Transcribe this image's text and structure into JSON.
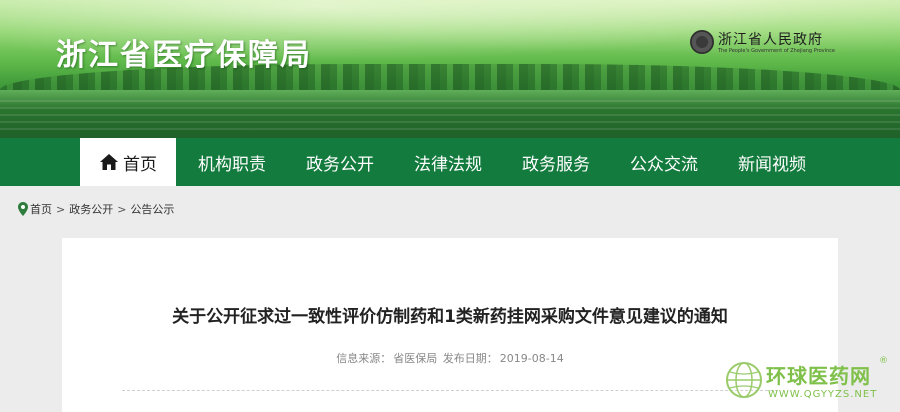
{
  "header": {
    "site_title": "浙江省医疗保障局",
    "gov_name": "浙江省人民政府",
    "gov_subtitle": "The People's Government of Zhejiang Province"
  },
  "nav": {
    "items": [
      {
        "label": "首页",
        "icon": "home-icon",
        "active": true
      },
      {
        "label": "机构职责"
      },
      {
        "label": "政务公开"
      },
      {
        "label": "法律法规"
      },
      {
        "label": "政务服务"
      },
      {
        "label": "公众交流"
      },
      {
        "label": "新闻视频"
      }
    ]
  },
  "breadcrumb": {
    "icon": "location-pin-icon",
    "items": [
      "首页",
      "政务公开",
      "公告公示"
    ],
    "separator": ">"
  },
  "article": {
    "title": "关于公开征求过一致性评价仿制药和1类新药挂网采购文件意见建议的通知",
    "source_label": "信息来源：",
    "source": "省医保局",
    "date_label": "发布日期：",
    "date": "2019-08-14"
  },
  "watermark": {
    "name": "环球医药网",
    "registered": "®",
    "url": "WWW.QGYYZS.NET"
  },
  "colors": {
    "nav_green": "#137b3e",
    "watermark_green": "#7fc04a"
  }
}
